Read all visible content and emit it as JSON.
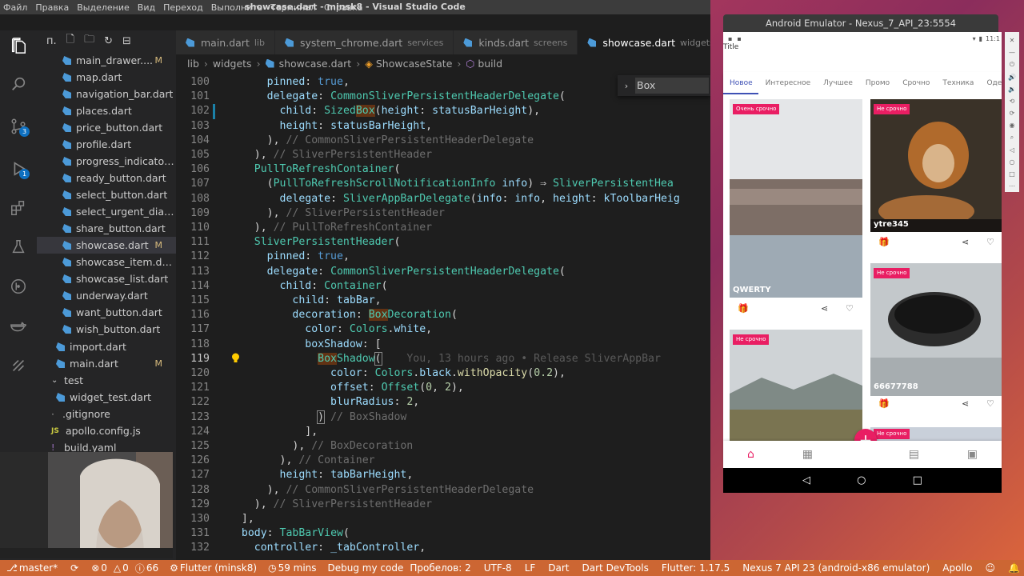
{
  "window_title": "showcase.dart - minsk8 - Visual Studio Code",
  "menu": [
    "Файл",
    "Правка",
    "Выделение",
    "Вид",
    "Переход",
    "Выполнить",
    "Терминал",
    "Справка"
  ],
  "activity_bar": {
    "icons": [
      "files-icon",
      "search-icon",
      "source-control-icon",
      "debug-icon",
      "extensions-icon",
      "flask-icon",
      "git-graph-icon",
      "docker-icon",
      "liveshare-icon"
    ],
    "badges": {
      "source_control": "3",
      "debug": "1"
    }
  },
  "explorer": {
    "title_abbrev": "п.",
    "files": [
      {
        "name": "main_drawer....",
        "status": "M",
        "type": "dart"
      },
      {
        "name": "map.dart",
        "status": "",
        "type": "dart"
      },
      {
        "name": "navigation_bar.dart",
        "status": "",
        "type": "dart"
      },
      {
        "name": "places.dart",
        "status": "",
        "type": "dart"
      },
      {
        "name": "price_button.dart",
        "status": "",
        "type": "dart"
      },
      {
        "name": "profile.dart",
        "status": "",
        "type": "dart"
      },
      {
        "name": "progress_indicator....",
        "status": "",
        "type": "dart"
      },
      {
        "name": "ready_button.dart",
        "status": "",
        "type": "dart"
      },
      {
        "name": "select_button.dart",
        "status": "",
        "type": "dart"
      },
      {
        "name": "select_urgent_dialo...",
        "status": "",
        "type": "dart"
      },
      {
        "name": "share_button.dart",
        "status": "",
        "type": "dart"
      },
      {
        "name": "showcase.dart",
        "status": "M",
        "type": "dart"
      },
      {
        "name": "showcase_item.dart",
        "status": "",
        "type": "dart"
      },
      {
        "name": "showcase_list.dart",
        "status": "",
        "type": "dart"
      },
      {
        "name": "underway.dart",
        "status": "",
        "type": "dart"
      },
      {
        "name": "want_button.dart",
        "status": "",
        "type": "dart"
      },
      {
        "name": "wish_button.dart",
        "status": "",
        "type": "dart"
      },
      {
        "name": "import.dart",
        "status": "",
        "type": "dart"
      },
      {
        "name": "main.dart",
        "status": "M",
        "type": "dart"
      },
      {
        "name": "test",
        "status": "",
        "type": "folder"
      },
      {
        "name": "widget_test.dart",
        "status": "",
        "type": "dart"
      },
      {
        "name": ".gitignore",
        "status": "",
        "type": "dot"
      },
      {
        "name": "apollo.config.js",
        "status": "",
        "type": "js"
      },
      {
        "name": "build.yaml",
        "status": "",
        "type": "yaml"
      }
    ]
  },
  "tabs": [
    {
      "name": "main.dart",
      "dir": "lib",
      "active": false
    },
    {
      "name": "system_chrome.dart",
      "dir": "services",
      "active": false
    },
    {
      "name": "kinds.dart",
      "dir": "screens",
      "active": false
    },
    {
      "name": "showcase.dart",
      "dir": "widgets",
      "active": true
    }
  ],
  "breadcrumb": [
    "lib",
    "widgets",
    "showcase.dart",
    "ShowcaseState",
    "build"
  ],
  "find_widget": {
    "query": "Box"
  },
  "code_lines": [
    {
      "n": "100",
      "tokens": [
        [
          "",
          "      "
        ],
        [
          "p",
          "pinned"
        ],
        [
          "",
          ": "
        ],
        [
          "kb",
          "true"
        ],
        [
          "",
          ","
        ]
      ]
    },
    {
      "n": "101",
      "tokens": [
        [
          "",
          "      "
        ],
        [
          "p",
          "delegate"
        ],
        [
          "",
          ": "
        ],
        [
          "t",
          "CommonSliverPersistentHeaderDelegate"
        ],
        [
          "",
          "("
        ]
      ]
    },
    {
      "n": "102",
      "tokens": [
        [
          "",
          "        "
        ],
        [
          "p",
          "child"
        ],
        [
          "",
          ": "
        ],
        [
          "t",
          "Sized"
        ],
        [
          "t hl",
          "Box"
        ],
        [
          "",
          "("
        ],
        [
          "p",
          "height"
        ],
        [
          "",
          ": "
        ],
        [
          "p",
          "statusBarHeight"
        ],
        [
          "",
          "),"
        ]
      ]
    },
    {
      "n": "103",
      "tokens": [
        [
          "",
          "        "
        ],
        [
          "p",
          "height"
        ],
        [
          "",
          ": "
        ],
        [
          "p",
          "statusBarHeight"
        ],
        [
          "",
          ","
        ]
      ]
    },
    {
      "n": "104",
      "tokens": [
        [
          "",
          "      ), "
        ],
        [
          "cm",
          "// CommonSliverPersistentHeaderDelegate"
        ]
      ]
    },
    {
      "n": "105",
      "tokens": [
        [
          "",
          "    ), "
        ],
        [
          "cm",
          "// SliverPersistentHeader"
        ]
      ]
    },
    {
      "n": "106",
      "tokens": [
        [
          "",
          "    "
        ],
        [
          "t",
          "PullToRefreshContainer"
        ],
        [
          "",
          "("
        ]
      ]
    },
    {
      "n": "107",
      "tokens": [
        [
          "",
          "      ("
        ],
        [
          "t",
          "PullToRefreshScrollNotificationInfo"
        ],
        [
          "",
          " "
        ],
        [
          "p",
          "info"
        ],
        [
          "",
          ") ⇒ "
        ],
        [
          "t",
          "SliverPersistentHea"
        ]
      ]
    },
    {
      "n": "108",
      "tokens": [
        [
          "",
          "        "
        ],
        [
          "p",
          "delegate"
        ],
        [
          "",
          ": "
        ],
        [
          "t",
          "SliverAppBarDelegate"
        ],
        [
          "",
          "("
        ],
        [
          "p",
          "info"
        ],
        [
          "",
          ": "
        ],
        [
          "p",
          "info"
        ],
        [
          "",
          ", "
        ],
        [
          "p",
          "height"
        ],
        [
          "",
          ": "
        ],
        [
          "p",
          "kToolbarHeig"
        ]
      ]
    },
    {
      "n": "109",
      "tokens": [
        [
          "",
          "      ), "
        ],
        [
          "cm",
          "// SliverPersistentHeader"
        ]
      ]
    },
    {
      "n": "110",
      "tokens": [
        [
          "",
          "    ), "
        ],
        [
          "cm",
          "// PullToRefreshContainer"
        ]
      ]
    },
    {
      "n": "111",
      "tokens": [
        [
          "",
          "    "
        ],
        [
          "t",
          "SliverPersistentHeader"
        ],
        [
          "",
          "("
        ]
      ]
    },
    {
      "n": "112",
      "tokens": [
        [
          "",
          "      "
        ],
        [
          "p",
          "pinned"
        ],
        [
          "",
          ": "
        ],
        [
          "kb",
          "true"
        ],
        [
          "",
          ","
        ]
      ]
    },
    {
      "n": "113",
      "tokens": [
        [
          "",
          "      "
        ],
        [
          "p",
          "delegate"
        ],
        [
          "",
          ": "
        ],
        [
          "t",
          "CommonSliverPersistentHeaderDelegate"
        ],
        [
          "",
          "("
        ]
      ]
    },
    {
      "n": "114",
      "tokens": [
        [
          "",
          "        "
        ],
        [
          "p",
          "child"
        ],
        [
          "",
          ": "
        ],
        [
          "t",
          "Container"
        ],
        [
          "",
          "("
        ]
      ]
    },
    {
      "n": "115",
      "tokens": [
        [
          "",
          "          "
        ],
        [
          "p",
          "child"
        ],
        [
          "",
          ": "
        ],
        [
          "p",
          "tabBar"
        ],
        [
          "",
          ","
        ]
      ]
    },
    {
      "n": "116",
      "tokens": [
        [
          "",
          "          "
        ],
        [
          "p",
          "decoration"
        ],
        [
          "",
          ": "
        ],
        [
          "t hl",
          "Box"
        ],
        [
          "t",
          "Decoration"
        ],
        [
          "",
          "("
        ]
      ]
    },
    {
      "n": "117",
      "tokens": [
        [
          "",
          "            "
        ],
        [
          "p",
          "color"
        ],
        [
          "",
          ": "
        ],
        [
          "t",
          "Colors"
        ],
        [
          "",
          "."
        ],
        [
          "p",
          "white"
        ],
        [
          "",
          ","
        ]
      ]
    },
    {
      "n": "118",
      "tokens": [
        [
          "",
          "            "
        ],
        [
          "p",
          "boxShadow"
        ],
        [
          "",
          ": ["
        ]
      ]
    },
    {
      "n": "119",
      "tokens": [
        [
          "",
          "              "
        ],
        [
          "t hl",
          "Box"
        ],
        [
          "t",
          "Shadow"
        ],
        [
          "hb",
          "("
        ],
        [
          "",
          "    "
        ],
        [
          "ghost",
          "You, 13 hours ago • Release SliverAppBar"
        ]
      ]
    },
    {
      "n": "120",
      "tokens": [
        [
          "",
          "                "
        ],
        [
          "p",
          "color"
        ],
        [
          "",
          ": "
        ],
        [
          "t",
          "Colors"
        ],
        [
          "",
          "."
        ],
        [
          "p",
          "black"
        ],
        [
          "",
          "."
        ],
        [
          "f",
          "withOpacity"
        ],
        [
          "",
          "("
        ],
        [
          "n",
          "0.2"
        ],
        [
          "",
          "),"
        ]
      ]
    },
    {
      "n": "121",
      "tokens": [
        [
          "",
          "                "
        ],
        [
          "p",
          "offset"
        ],
        [
          "",
          ": "
        ],
        [
          "t",
          "Offset"
        ],
        [
          "",
          "("
        ],
        [
          "n",
          "0"
        ],
        [
          "",
          ", "
        ],
        [
          "n",
          "2"
        ],
        [
          "",
          "),"
        ]
      ]
    },
    {
      "n": "122",
      "tokens": [
        [
          "",
          "                "
        ],
        [
          "p",
          "blurRadius"
        ],
        [
          "",
          ": "
        ],
        [
          "n",
          "2"
        ],
        [
          "",
          ","
        ]
      ]
    },
    {
      "n": "123",
      "tokens": [
        [
          "",
          "              "
        ],
        [
          "hb",
          ")"
        ],
        [
          "",
          " "
        ],
        [
          "cm",
          "// BoxShadow"
        ]
      ]
    },
    {
      "n": "124",
      "tokens": [
        [
          "",
          "            ],"
        ]
      ]
    },
    {
      "n": "125",
      "tokens": [
        [
          "",
          "          ), "
        ],
        [
          "cm",
          "// BoxDecoration"
        ]
      ]
    },
    {
      "n": "126",
      "tokens": [
        [
          "",
          "        ), "
        ],
        [
          "cm",
          "// Container"
        ]
      ]
    },
    {
      "n": "127",
      "tokens": [
        [
          "",
          "        "
        ],
        [
          "p",
          "height"
        ],
        [
          "",
          ": "
        ],
        [
          "p",
          "tabBarHeight"
        ],
        [
          "",
          ","
        ]
      ]
    },
    {
      "n": "128",
      "tokens": [
        [
          "",
          "      ), "
        ],
        [
          "cm",
          "// CommonSliverPersistentHeaderDelegate"
        ]
      ]
    },
    {
      "n": "129",
      "tokens": [
        [
          "",
          "    ), "
        ],
        [
          "cm",
          "// SliverPersistentHeader"
        ]
      ]
    },
    {
      "n": "130",
      "tokens": [
        [
          "",
          "  ],"
        ]
      ]
    },
    {
      "n": "131",
      "tokens": [
        [
          "",
          "  "
        ],
        [
          "p",
          "body"
        ],
        [
          "",
          ": "
        ],
        [
          "t",
          "TabBarView"
        ],
        [
          "",
          "("
        ]
      ]
    },
    {
      "n": "132",
      "tokens": [
        [
          "",
          "    "
        ],
        [
          "p",
          "controller"
        ],
        [
          "",
          ": "
        ],
        [
          "p",
          "_tabController"
        ],
        [
          "",
          ","
        ]
      ]
    }
  ],
  "statusbar": {
    "branch": "master*",
    "errors": "0",
    "warnings": "0",
    "infos": "66",
    "flutter": "Flutter (minsk8)",
    "time": "59 mins",
    "debug": "Debug my code",
    "spaces": "Пробелов: 2",
    "encoding": "UTF-8",
    "eol": "LF",
    "language": "Dart",
    "devtools": "Dart DevTools",
    "flutter_version": "Flutter: 1.17.5",
    "device": "Nexus 7 API 23 (android-x86 emulator)",
    "apollo": "Apollo"
  },
  "emulator": {
    "window_title": "Android Emulator - Nexus_7_API_23:5554",
    "phone_time": "11:1",
    "app_title": "Title",
    "tabs": [
      "Новое",
      "Интересное",
      "Лучшее",
      "Промо",
      "Срочно",
      "Техника",
      "Одежда"
    ],
    "cards": [
      {
        "tag": "Очень срочно",
        "label": "QWERTY"
      },
      {
        "tag": "Не срочно",
        "label": "ytre345"
      },
      {
        "tag": "Не срочно",
        "label": "66677788"
      },
      {
        "tag": "Не срочно",
        "label": ""
      },
      {
        "tag": "Не срочно",
        "label": ""
      }
    ],
    "accent_color": "#e91e63",
    "tab_indicator_color": "#3f51b5"
  }
}
